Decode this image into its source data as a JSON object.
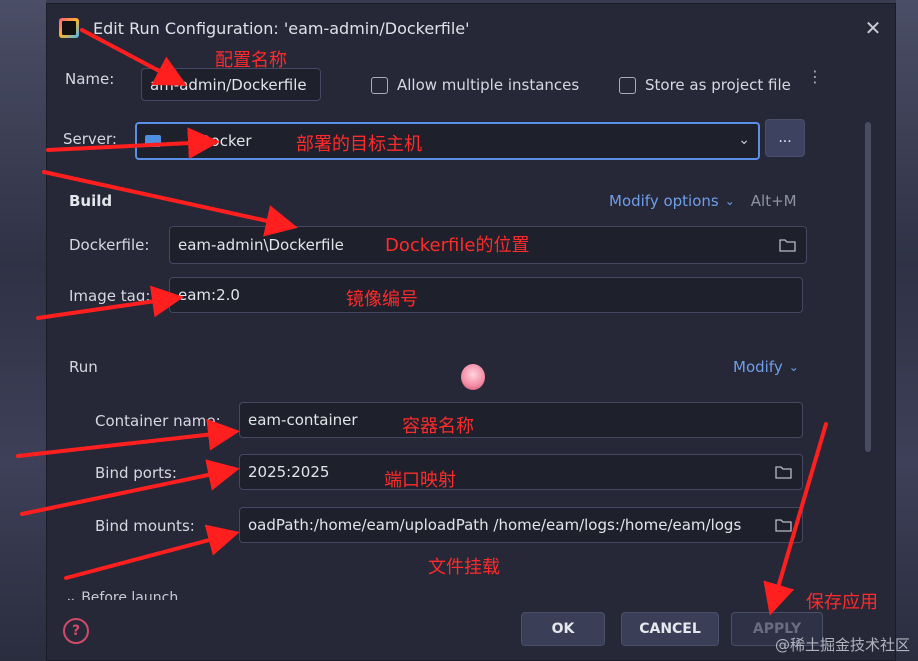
{
  "window": {
    "title": "Edit Run Configuration: 'eam-admin/Dockerfile'"
  },
  "name_row": {
    "label": "Name:",
    "value": "am-admin/Dockerfile",
    "allow_multiple": "Allow multiple instances",
    "store_as_project": "Store as project file"
  },
  "server_row": {
    "label": "Server:",
    "value": "Docker",
    "browse": "..."
  },
  "build": {
    "title": "Build",
    "modify_options": "Modify options",
    "shortcut": "Alt+M",
    "dockerfile_label": "Dockerfile:",
    "dockerfile_value": "eam-admin\\Dockerfile",
    "image_tag_label": "Image tag:",
    "image_tag_value": "eam:2.0"
  },
  "run": {
    "title": "Run",
    "modify": "Modify",
    "container_label": "Container name:",
    "container_value": "eam-container",
    "ports_label": "Bind ports:",
    "ports_value": "2025:2025",
    "mounts_label": "Bind mounts:",
    "mounts_value": "oadPath:/home/eam/uploadPath  /home/eam/logs:/home/eam/logs"
  },
  "before_launch": "Before launch",
  "buttons": {
    "ok": "OK",
    "cancel": "CANCEL",
    "apply": "APPLY"
  },
  "annotations": {
    "config_name": "配置名称",
    "target_host": "部署的目标主机",
    "dockerfile_location": "Dockerfile的位置",
    "image_tag": "镜像编号",
    "container_name": "容器名称",
    "port_mapping": "端口映射",
    "file_mount": "文件挂载",
    "save_apply": "保存应用"
  },
  "watermark": "@稀土掘金技术社区",
  "colors": {
    "accent_link": "#6f9ee8",
    "annotation_red": "#ff2a2a",
    "dialog_bg": "#262838"
  }
}
